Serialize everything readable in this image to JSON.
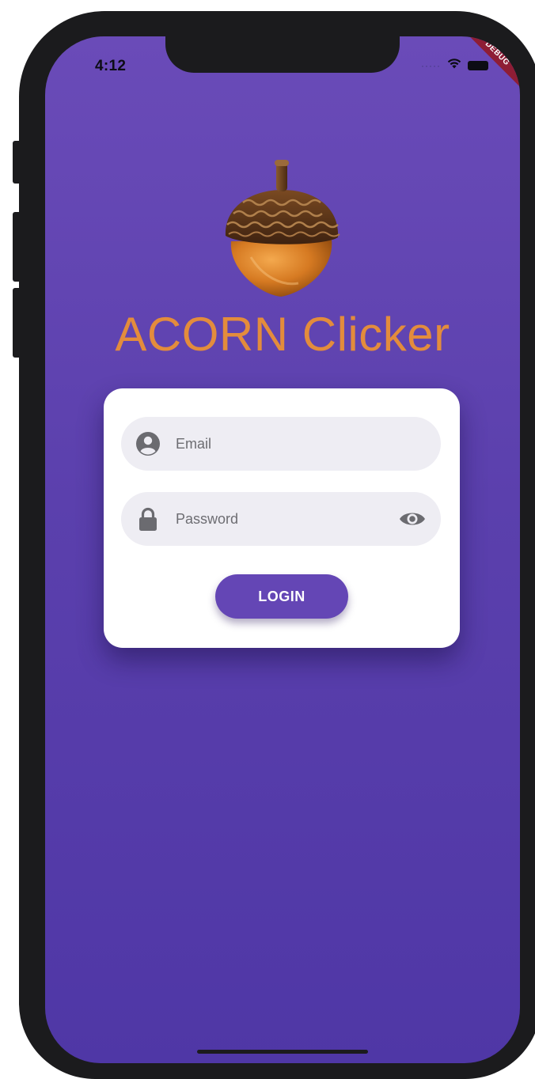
{
  "status_bar": {
    "time": "4:12",
    "signal_dots": "·····"
  },
  "debug_banner": {
    "label": "DEBUG"
  },
  "app": {
    "title": "ACORN Clicker",
    "title_color": "#e38c3c"
  },
  "login_form": {
    "email": {
      "placeholder": "Email",
      "value": ""
    },
    "password": {
      "placeholder": "Password",
      "value": ""
    },
    "login_label": "LOGIN"
  },
  "theme": {
    "background": "#5b40ad",
    "accent": "#6446b5",
    "card": "#ffffff",
    "field_fill": "#eeedf3"
  },
  "icons": {
    "logo": "acorn-icon",
    "email": "person-circle-icon",
    "password": "lock-icon",
    "visibility": "eye-icon",
    "wifi": "wifi-icon",
    "battery": "battery-icon"
  }
}
